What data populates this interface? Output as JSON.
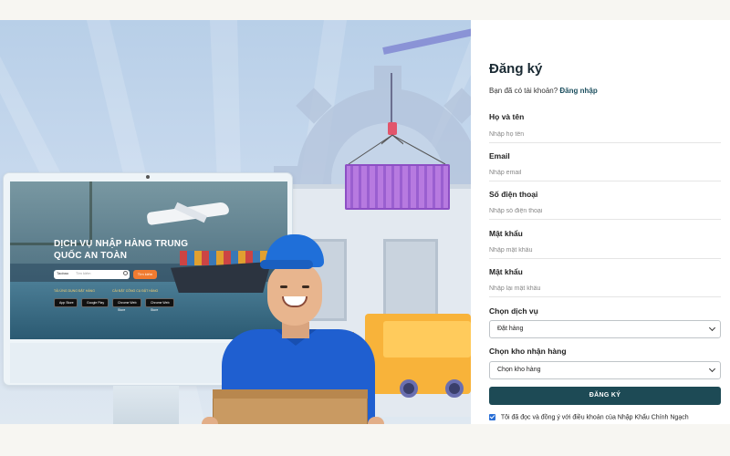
{
  "illustration": {
    "screen_title_line1": "DỊCH VỤ NHẬP HÀNG TRUNG",
    "screen_title_line2": "QUỐC AN TOÀN",
    "screen_search_select": "Taobao",
    "screen_search_placeholder": "Tìm kiếm",
    "screen_search_button": "Tìm kiếm",
    "screen_label_app": "TẢI ỨNG DỤNG ĐẶT HÀNG",
    "screen_label_ext": "CÀI ĐẶT CÔNG CỤ ĐẶT HÀNG",
    "badges": [
      "App Store",
      "Google Play",
      "Chrome Web Store",
      "Chrome Web Store"
    ]
  },
  "form": {
    "title": "Đăng ký",
    "login_prompt": "Bạn đã có tài khoản?",
    "login_link": "Đăng nhập",
    "fields": [
      {
        "label": "Họ và tên",
        "placeholder": "Nhập họ tên"
      },
      {
        "label": "Email",
        "placeholder": "Nhập email"
      },
      {
        "label": "Số điện thoại",
        "placeholder": "Nhập số điện thoại"
      },
      {
        "label": "Mật khẩu",
        "placeholder": "Nhập mật khẩu"
      },
      {
        "label": "Mật khẩu",
        "placeholder": "Nhập lại mật khẩu"
      }
    ],
    "service_label": "Chọn dịch vụ",
    "service_value": "Đặt hàng",
    "warehouse_label": "Chọn kho nhận hàng",
    "warehouse_value": "Chọn kho hàng",
    "submit_label": "ĐĂNG KÝ",
    "terms_text": "Tôi đã đọc và đồng ý với điều khoản của Nhập Khẩu Chính Ngạch",
    "terms_checked": true
  },
  "colors": {
    "primary": "#1d4a55",
    "checkbox": "#2a6fd6",
    "cap": "#1f6fd9",
    "container": "#b77ae0",
    "truck": "#f8b33a"
  }
}
